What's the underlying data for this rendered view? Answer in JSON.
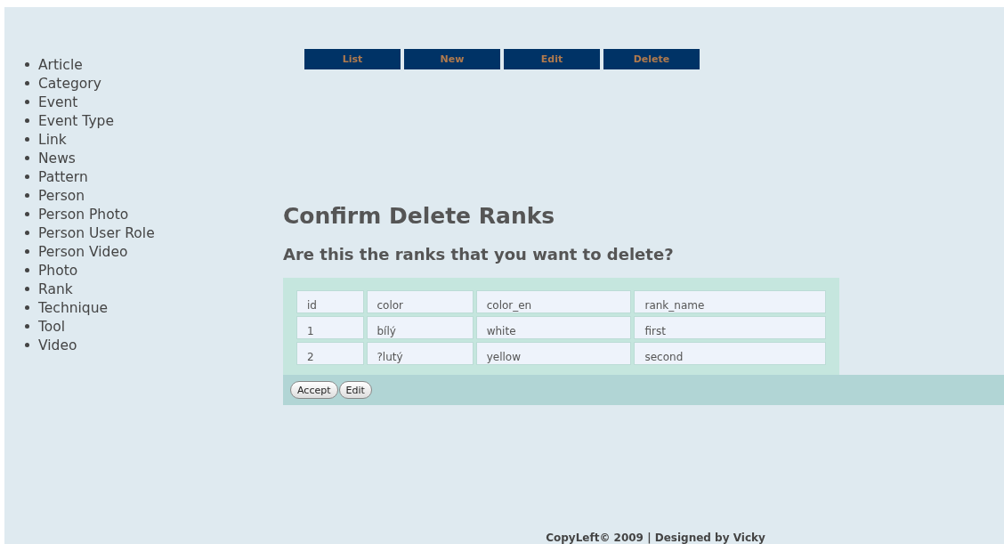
{
  "sidebar": {
    "items": [
      {
        "label": "Article"
      },
      {
        "label": "Category"
      },
      {
        "label": "Event"
      },
      {
        "label": "Event Type"
      },
      {
        "label": "Link"
      },
      {
        "label": "News"
      },
      {
        "label": "Pattern"
      },
      {
        "label": "Person"
      },
      {
        "label": "Person Photo"
      },
      {
        "label": "Person User Role"
      },
      {
        "label": "Person Video"
      },
      {
        "label": "Photo"
      },
      {
        "label": "Rank"
      },
      {
        "label": "Technique"
      },
      {
        "label": "Tool"
      },
      {
        "label": "Video"
      }
    ]
  },
  "nav": [
    "List",
    "New",
    "Edit",
    "Delete"
  ],
  "heading": "Confirm Delete Ranks",
  "subheading": "Are this the ranks that you want to delete?",
  "table": {
    "columns": [
      "id",
      "color",
      "color_en",
      "rank_name"
    ],
    "rows": [
      [
        "1",
        "bílý",
        "white",
        "first"
      ],
      [
        "2",
        "?lutý",
        "yellow",
        "second"
      ]
    ]
  },
  "buttons": [
    "Accept",
    "Edit"
  ],
  "footer": "CopyLeft© 2009 | Designed by Vicky"
}
